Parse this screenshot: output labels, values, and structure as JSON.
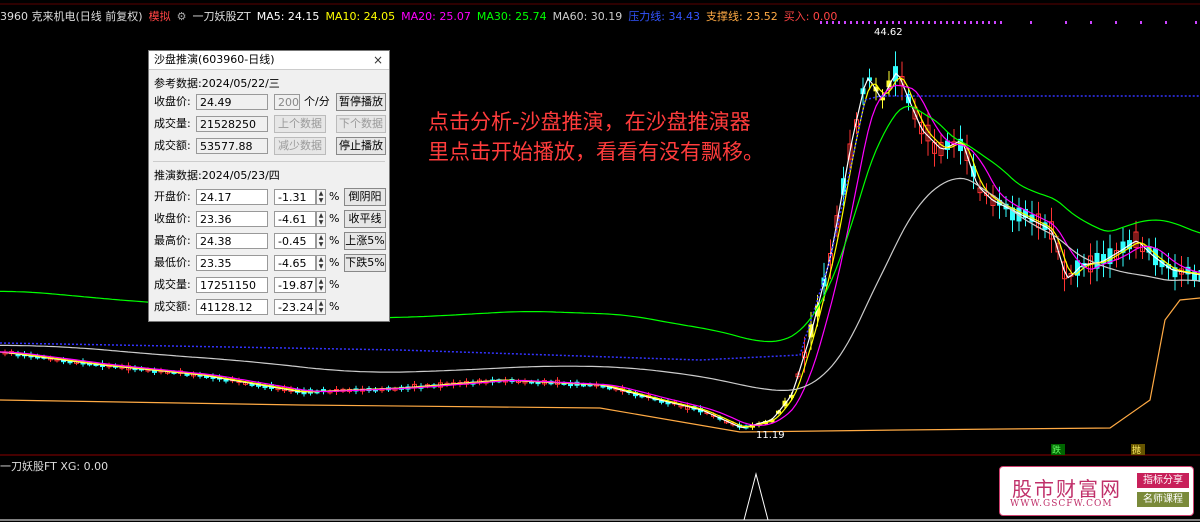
{
  "header": {
    "stock_label": "3960 克来机电(日线 前复权)",
    "mode_label": "模拟",
    "indicator_name": "一刀妖股ZT",
    "ma5": "MA5: 24.15",
    "ma10": "MA10: 24.05",
    "ma20": "MA20: 25.07",
    "ma30": "MA30: 25.74",
    "ma60": "MA60: 30.19",
    "pressure": "压力线: 34.43",
    "support": "支撑线: 23.52",
    "buy": "买入: 0.00"
  },
  "sub_indicator": {
    "label": "一刀妖股FT XG: 0.00"
  },
  "annotations": {
    "high_price": "44.62",
    "low_price": "11.19",
    "sell_signal": "跌",
    "buy_signal": "抛"
  },
  "note": {
    "line1": "点击分析-沙盘推演，在沙盘推演器",
    "line2": "里点击开始播放，看看有没有飘移。"
  },
  "dialog": {
    "title": "沙盘推演(603960-日线)",
    "close": "×",
    "ref_section": "参考数据:2024/05/22/三",
    "ref": {
      "close_label": "收盘价:",
      "close_value": "24.49",
      "volume_label": "成交量:",
      "volume_value": "21528250",
      "amount_label": "成交额:",
      "amount_value": "53577.88",
      "speed_value": "200",
      "speed_unit": "个/分",
      "pause_btn": "暂停播放",
      "prev_btn": "上个数据",
      "next_btn": "下个数据",
      "slower_btn": "减少数据",
      "stop_btn": "停止播放"
    },
    "sim_section": "推演数据:2024/05/23/四",
    "sim_rows": [
      {
        "label": "开盘价:",
        "value": "24.17",
        "pct": "-1.31",
        "btn": "倒阴阳"
      },
      {
        "label": "收盘价:",
        "value": "23.36",
        "pct": "-4.61",
        "btn": "收平线"
      },
      {
        "label": "最高价:",
        "value": "24.38",
        "pct": "-0.45",
        "btn": "上涨5%"
      },
      {
        "label": "最低价:",
        "value": "23.35",
        "pct": "-4.65",
        "btn": "下跌5%"
      },
      {
        "label": "成交量:",
        "value": "17251150",
        "pct": "-19.87",
        "btn": ""
      },
      {
        "label": "成交额:",
        "value": "41128.12",
        "pct": "-23.24",
        "btn": ""
      }
    ],
    "pct_sign": "%"
  },
  "watermark": {
    "site_cn": "股市财富网",
    "site_url": "WWW.GSCFW.COM",
    "tag1": "指标分享",
    "tag2": "名师课程"
  },
  "colors": {
    "ma5": "#ffffff",
    "ma10": "#ffff00",
    "ma20": "#ff00ff",
    "ma30": "#00ff00",
    "ma60": "#cccccc",
    "pressure": "#3333ff",
    "support": "#ffaa44",
    "up_candle": "#ff3333",
    "down_candle": "#33ffff",
    "yellow_candle": "#ffff33",
    "note": "#ff3c3c"
  }
}
